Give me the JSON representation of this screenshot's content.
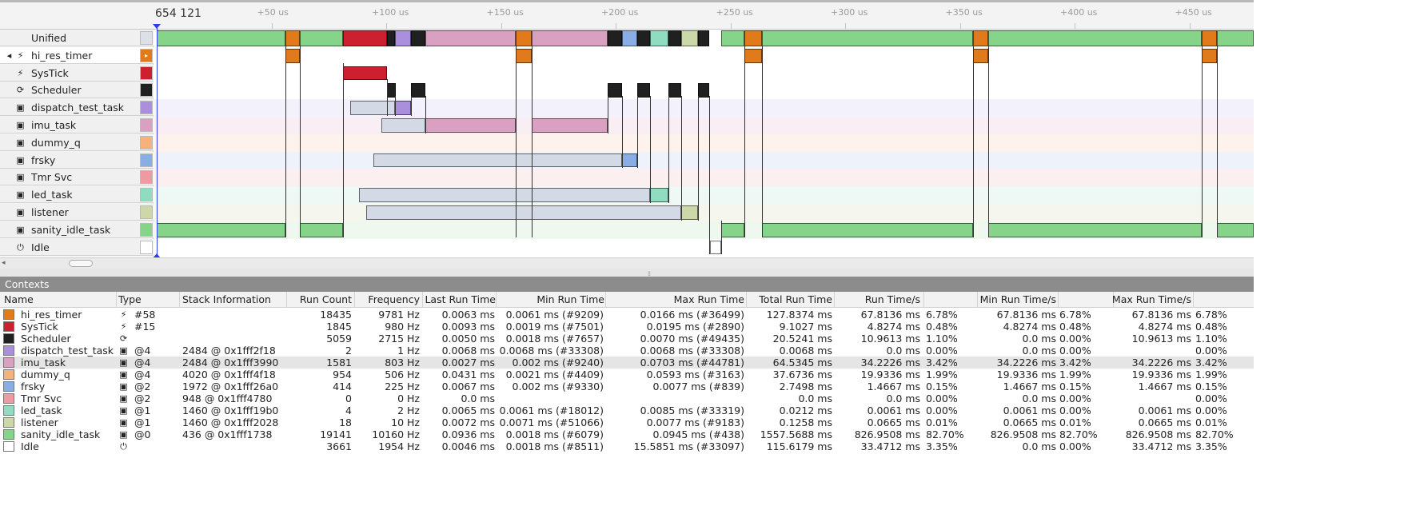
{
  "ruler": {
    "origin": "654 121",
    "ticks": [
      "+50 us",
      "+100 us",
      "+150 us",
      "+200 us",
      "+250 us",
      "+300 us",
      "+350 us",
      "+400 us",
      "+450 us"
    ]
  },
  "colors": {
    "hi_res_timer": "#e07a1a",
    "SysTick": "#cc2030",
    "Scheduler": "#202020",
    "dispatch_test_task": "#a98fdc",
    "imu_task": "#d9a0c2",
    "dummy_q": "#f5b27a",
    "frsky": "#89aee6",
    "Tmr Svc": "#ee9aa0",
    "led_task": "#8fdcc1",
    "listener": "#ccd8a8",
    "sanity_idle_task": "#86d48a",
    "Idle": "#ffffff",
    "Unified": "#dde0e8",
    "wait_bar": "#d3dae6",
    "cursor": "#2c3df0"
  },
  "rows": [
    {
      "label": "Unified",
      "icon": ""
    },
    {
      "label": "hi_res_timer",
      "icon": "interrupt-icon"
    },
    {
      "label": "SysTick",
      "icon": "interrupt-icon"
    },
    {
      "label": "Scheduler",
      "icon": "scheduler-icon"
    },
    {
      "label": "dispatch_test_task",
      "icon": "task-icon"
    },
    {
      "label": "imu_task",
      "icon": "task-icon"
    },
    {
      "label": "dummy_q",
      "icon": "task-icon"
    },
    {
      "label": "frsky",
      "icon": "task-icon"
    },
    {
      "label": "Tmr Svc",
      "icon": "task-icon"
    },
    {
      "label": "led_task",
      "icon": "task-icon"
    },
    {
      "label": "listener",
      "icon": "task-icon"
    },
    {
      "label": "sanity_idle_task",
      "icon": "task-icon"
    },
    {
      "label": "Idle",
      "icon": "idle-icon"
    }
  ],
  "contexts": {
    "title": "Contexts",
    "columns": [
      "Name",
      "Type",
      "Stack Information",
      "Run Count",
      "Frequency",
      "Last Run Time",
      "Min Run Time",
      "Max Run Time",
      "Total Run Time",
      "Run Time/s",
      "Min Run Time/s",
      "Max Run Time/s"
    ],
    "rows": [
      {
        "name": "hi_res_timer",
        "type_icon": "interrupt-icon",
        "type": "#58",
        "stack": "",
        "run_count": "18435",
        "frequency": "9781 Hz",
        "last_run": "0.0063 ms",
        "min_run": "0.0061 ms (#9209)",
        "max_run": "0.0166 ms (#36499)",
        "total_run": "127.8374 ms",
        "rts": "67.8136 ms",
        "rts_pct": "6.78%",
        "min_rts": "67.8136 ms",
        "min_rts_pct": "6.78%",
        "max_rts": "67.8136 ms",
        "max_rts_pct": "6.78%"
      },
      {
        "name": "SysTick",
        "type_icon": "interrupt-icon",
        "type": "#15",
        "stack": "",
        "run_count": "1845",
        "frequency": "980 Hz",
        "last_run": "0.0093 ms",
        "min_run": "0.0019 ms (#7501)",
        "max_run": "0.0195 ms (#2890)",
        "total_run": "9.1027 ms",
        "rts": "4.8274 ms",
        "rts_pct": "0.48%",
        "min_rts": "4.8274 ms",
        "min_rts_pct": "0.48%",
        "max_rts": "4.8274 ms",
        "max_rts_pct": "0.48%"
      },
      {
        "name": "Scheduler",
        "type_icon": "scheduler-icon",
        "type": "",
        "stack": "",
        "run_count": "5059",
        "frequency": "2715 Hz",
        "last_run": "0.0050 ms",
        "min_run": "0.0018 ms (#7657)",
        "max_run": "0.0070 ms (#49435)",
        "total_run": "20.5241 ms",
        "rts": "10.9613 ms",
        "rts_pct": "1.10%",
        "min_rts": "0.0 ms",
        "min_rts_pct": "0.00%",
        "max_rts": "10.9613 ms",
        "max_rts_pct": "1.10%"
      },
      {
        "name": "dispatch_test_task",
        "type_icon": "task-icon",
        "type": "@4",
        "stack": "2484 @ 0x1fff2f18",
        "run_count": "2",
        "frequency": "1 Hz",
        "last_run": "0.0068 ms",
        "min_run": "0.0068 ms (#33308)",
        "max_run": "0.0068 ms (#33308)",
        "total_run": "0.0068 ms",
        "rts": "0.0 ms",
        "rts_pct": "0.00%",
        "min_rts": "0.0 ms",
        "min_rts_pct": "0.00%",
        "max_rts": "",
        "max_rts_pct": "0.00%"
      },
      {
        "name": "imu_task",
        "type_icon": "task-icon",
        "type": "@4",
        "stack": "2484 @ 0x1fff3990",
        "run_count": "1581",
        "frequency": "803 Hz",
        "last_run": "0.0027 ms",
        "min_run": "0.002 ms (#9240)",
        "max_run": "0.0703 ms (#44781)",
        "total_run": "64.5345 ms",
        "rts": "34.2226 ms",
        "rts_pct": "3.42%",
        "min_rts": "34.2226 ms",
        "min_rts_pct": "3.42%",
        "max_rts": "34.2226 ms",
        "max_rts_pct": "3.42%"
      },
      {
        "name": "dummy_q",
        "type_icon": "task-icon",
        "type": "@4",
        "stack": "4020 @ 0x1fff4f18",
        "run_count": "954",
        "frequency": "506 Hz",
        "last_run": "0.0431 ms",
        "min_run": "0.0021 ms (#4409)",
        "max_run": "0.0593 ms (#3163)",
        "total_run": "37.6736 ms",
        "rts": "19.9336 ms",
        "rts_pct": "1.99%",
        "min_rts": "19.9336 ms",
        "min_rts_pct": "1.99%",
        "max_rts": "19.9336 ms",
        "max_rts_pct": "1.99%"
      },
      {
        "name": "frsky",
        "type_icon": "task-icon",
        "type": "@2",
        "stack": "1972 @ 0x1fff26a0",
        "run_count": "414",
        "frequency": "225 Hz",
        "last_run": "0.0067 ms",
        "min_run": "0.002 ms (#9330)",
        "max_run": "0.0077 ms (#839)",
        "total_run": "2.7498 ms",
        "rts": "1.4667 ms",
        "rts_pct": "0.15%",
        "min_rts": "1.4667 ms",
        "min_rts_pct": "0.15%",
        "max_rts": "1.4667 ms",
        "max_rts_pct": "0.15%"
      },
      {
        "name": "Tmr Svc",
        "type_icon": "task-icon",
        "type": "@2",
        "stack": "948 @ 0x1fff4780",
        "run_count": "0",
        "frequency": "0 Hz",
        "last_run": "0.0 ms",
        "min_run": "",
        "max_run": "",
        "total_run": "0.0 ms",
        "rts": "0.0 ms",
        "rts_pct": "0.00%",
        "min_rts": "0.0 ms",
        "min_rts_pct": "0.00%",
        "max_rts": "",
        "max_rts_pct": "0.00%"
      },
      {
        "name": "led_task",
        "type_icon": "task-icon",
        "type": "@1",
        "stack": "1460 @ 0x1fff19b0",
        "run_count": "4",
        "frequency": "2 Hz",
        "last_run": "0.0065 ms",
        "min_run": "0.0061 ms (#18012)",
        "max_run": "0.0085 ms (#33319)",
        "total_run": "0.0212 ms",
        "rts": "0.0061 ms",
        "rts_pct": "0.00%",
        "min_rts": "0.0061 ms",
        "min_rts_pct": "0.00%",
        "max_rts": "0.0061 ms",
        "max_rts_pct": "0.00%"
      },
      {
        "name": "listener",
        "type_icon": "task-icon",
        "type": "@1",
        "stack": "1460 @ 0x1fff2028",
        "run_count": "18",
        "frequency": "10 Hz",
        "last_run": "0.0072 ms",
        "min_run": "0.0071 ms (#51066)",
        "max_run": "0.0077 ms (#9183)",
        "total_run": "0.1258 ms",
        "rts": "0.0665 ms",
        "rts_pct": "0.01%",
        "min_rts": "0.0665 ms",
        "min_rts_pct": "0.01%",
        "max_rts": "0.0665 ms",
        "max_rts_pct": "0.01%"
      },
      {
        "name": "sanity_idle_task",
        "type_icon": "task-icon",
        "type": "@0",
        "stack": "436 @ 0x1fff1738",
        "run_count": "19141",
        "frequency": "10160 Hz",
        "last_run": "0.0936 ms",
        "min_run": "0.0018 ms (#6079)",
        "max_run": "0.0945 ms (#438)",
        "total_run": "1557.5688 ms",
        "rts": "826.9508 ms",
        "rts_pct": "82.70%",
        "min_rts": "826.9508 ms",
        "min_rts_pct": "82.70%",
        "max_rts": "826.9508 ms",
        "max_rts_pct": "82.70%"
      },
      {
        "name": "Idle",
        "type_icon": "idle-icon",
        "type": "",
        "stack": "",
        "run_count": "3661",
        "frequency": "1954 Hz",
        "last_run": "0.0046 ms",
        "min_run": "0.0018 ms (#8511)",
        "max_run": "15.5851 ms (#33097)",
        "total_run": "115.6179 ms",
        "rts": "33.4712 ms",
        "rts_pct": "3.35%",
        "min_rts": "0.0 ms",
        "min_rts_pct": "0.00%",
        "max_rts": "33.4712 ms",
        "max_rts_pct": "3.35%"
      }
    ]
  }
}
